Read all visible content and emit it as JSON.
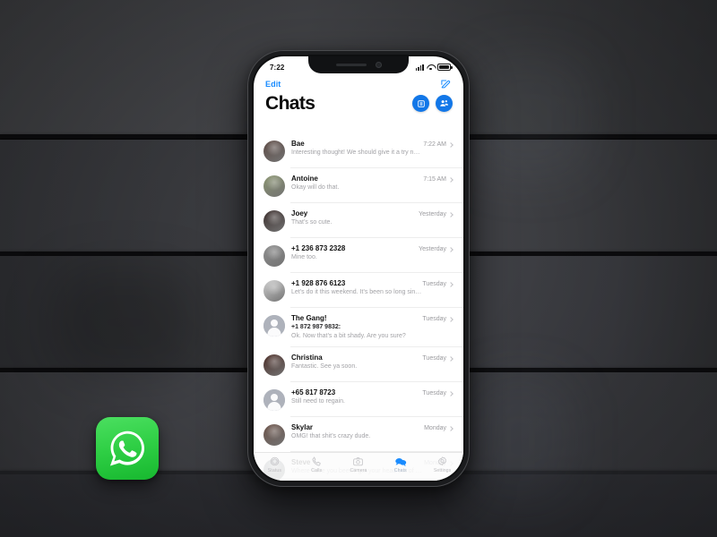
{
  "scene": {
    "background_color": "#3c3d40",
    "app_icon": {
      "name": "whatsapp-app-icon",
      "label": "WhatsApp",
      "color": "#25D366"
    }
  },
  "phone": {
    "status_bar": {
      "time": "7:22",
      "cellular": "signal-bars-icon",
      "wifi": "wifi-icon",
      "battery": "battery-icon"
    },
    "nav": {
      "edit_label": "Edit",
      "compose_icon": "compose-icon"
    },
    "header": {
      "title": "Chats",
      "actions": [
        {
          "name": "archived-chats-button",
          "icon": "archive-box-icon",
          "color": "#1277e8"
        },
        {
          "name": "new-group-button",
          "icon": "add-people-icon",
          "color": "#1277e8"
        }
      ]
    },
    "chats": [
      {
        "name": "Bae",
        "time": "7:22 AM",
        "preview": "Interesting thought! We should give it a try n…",
        "avatar": "photo",
        "avatar_color": "#5d4a44"
      },
      {
        "name": "Antoine",
        "time": "7:15 AM",
        "preview": "Okay will do that.",
        "avatar": "photo",
        "avatar_color": "#8a9470"
      },
      {
        "name": "Joey",
        "time": "Yesterday",
        "preview": "That’s so cute.",
        "avatar": "photo",
        "avatar_color": "#3a2d2b"
      },
      {
        "name": "+1 236 873 2328",
        "time": "Yesterday",
        "preview": "Mine too.",
        "avatar": "photo",
        "avatar_color": "#8e8e8e"
      },
      {
        "name": "+1 928 876 6123",
        "time": "Tuesday",
        "preview": "Let’s do it this weekend. It’s been so long sin…",
        "avatar": "photo",
        "avatar_color": "#cfcfcf"
      },
      {
        "name": "The Gang!",
        "time": "Tuesday",
        "sender": "+1 872 987 9832:",
        "preview": "Ok. Now that’s a bit shady. Are you sure?",
        "avatar": "placeholder",
        "avatar_color": "#aeb2bb"
      },
      {
        "name": "Christina",
        "time": "Tuesday",
        "preview": "Fantastic. See ya soon.",
        "avatar": "photo",
        "avatar_color": "#4a2c26"
      },
      {
        "name": "+65 817 8723",
        "time": "Tuesday",
        "preview": "Still need to regain.",
        "avatar": "placeholder",
        "avatar_color": "#aeb2bb"
      },
      {
        "name": "Skylar",
        "time": "Monday",
        "preview": "OMG! that shit’s crazy dude.",
        "avatar": "photo",
        "avatar_color": "#6b5248"
      },
      {
        "name": "Steve",
        "time": "Monday",
        "preview": "Where have you been? get your head out of …",
        "avatar": "photo",
        "avatar_color": "#5e6b74"
      }
    ],
    "tabs": [
      {
        "label": "Status",
        "icon": "status-ring-icon",
        "active": false
      },
      {
        "label": "Calls",
        "icon": "phone-icon",
        "active": false
      },
      {
        "label": "Camera",
        "icon": "camera-icon",
        "active": false
      },
      {
        "label": "Chats",
        "icon": "chat-bubbles-icon",
        "active": true
      },
      {
        "label": "Settings",
        "icon": "gear-icon",
        "active": false
      }
    ],
    "accent_color": "#1277e8",
    "link_color": "#1a8cff"
  }
}
